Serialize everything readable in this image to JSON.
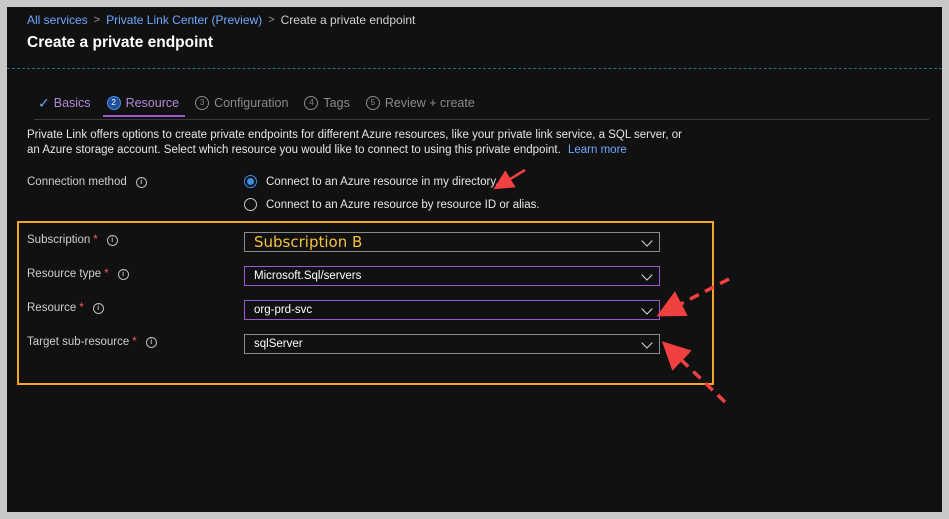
{
  "breadcrumb": {
    "items": [
      "All services",
      "Private Link Center (Preview)"
    ],
    "current": "Create a private endpoint"
  },
  "page": {
    "title": "Create a private endpoint"
  },
  "tabs": [
    {
      "label": "Basics",
      "state": "done"
    },
    {
      "num": "2",
      "label": "Resource",
      "state": "active"
    },
    {
      "num": "3",
      "label": "Configuration",
      "state": "pending"
    },
    {
      "num": "4",
      "label": "Tags",
      "state": "pending"
    },
    {
      "num": "5",
      "label": "Review + create",
      "state": "pending"
    }
  ],
  "description": {
    "text": "Private Link offers options to create private endpoints for different Azure resources, like your private link service, a SQL server, or an Azure storage account. Select which resource you would like to connect to using this private endpoint.",
    "link": "Learn more"
  },
  "connection": {
    "label": "Connection method",
    "options": [
      {
        "label": "Connect to an Azure resource in my directory.",
        "selected": true
      },
      {
        "label": "Connect to an Azure resource by resource ID or alias.",
        "selected": false
      }
    ]
  },
  "fields": {
    "subscription": {
      "label": "Subscription",
      "required": "*",
      "value": "Subscription B"
    },
    "resource_type": {
      "label": "Resource type",
      "required": "*",
      "value": "Microsoft.Sql/servers"
    },
    "resource": {
      "label": "Resource",
      "required": "*",
      "value": "org-prd-svc"
    },
    "target_sub_resource": {
      "label": "Target sub-resource",
      "required": "*",
      "value": "sqlServer"
    }
  },
  "icons": {
    "info": "i"
  },
  "colors": {
    "accent": "#3b8eea",
    "link": "#6ea8ff",
    "tab_active": "#9b59d0",
    "highlight_box": "#f5a623",
    "annotation_arrow": "#f04040",
    "required": "#ff5b5b"
  }
}
